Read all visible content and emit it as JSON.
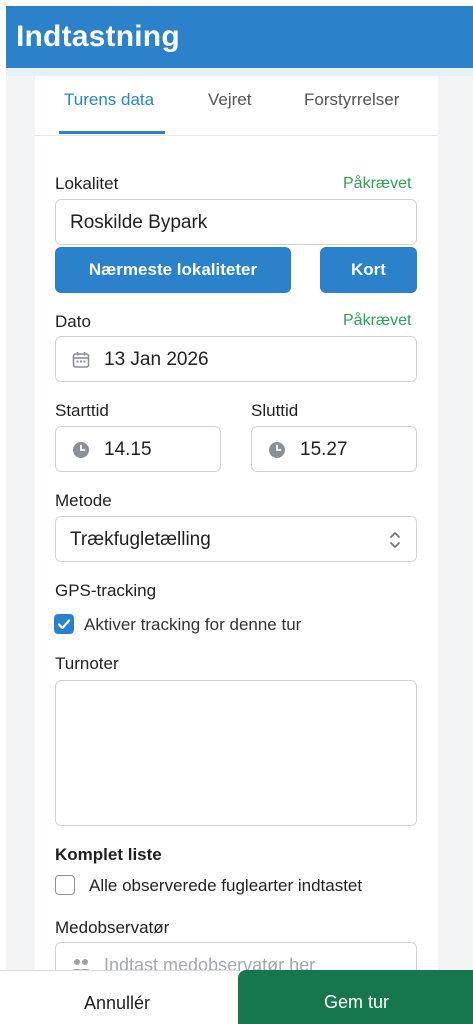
{
  "header": {
    "title": "Indtastning",
    "color": "#2b82cb"
  },
  "tabs": [
    {
      "label": "Turens data",
      "active": true
    },
    {
      "label": "Vejret",
      "active": false
    },
    {
      "label": "Forstyrrelser",
      "active": false
    }
  ],
  "locality": {
    "label": "Lokalitet",
    "required": "Påkrævet",
    "value": "Roskilde Bypark",
    "nearest_button": "Nærmeste lokaliteter",
    "map_button": "Kort"
  },
  "date": {
    "label": "Dato",
    "required": "Påkrævet",
    "value": "13 Jan 2026",
    "icon": "calendar-icon"
  },
  "start_time": {
    "label": "Starttid",
    "value": "14.15",
    "icon": "clock-icon"
  },
  "end_time": {
    "label": "Sluttid",
    "value": "15.27",
    "icon": "clock-icon"
  },
  "method": {
    "label": "Metode",
    "value": "Trækfugletælling",
    "icon": "updown-chevron-icon"
  },
  "gps": {
    "label": "GPS-tracking",
    "checkbox_label": "Aktiver tracking for denne tur",
    "checked": true
  },
  "notes": {
    "label": "Turnoter",
    "value": ""
  },
  "complete_list": {
    "label": "Komplet liste",
    "checkbox_label": "Alle observerede fuglearter indtastet",
    "checked": false
  },
  "co_observer": {
    "label": "Medobservatør",
    "placeholder": "Indtast medobservatør her",
    "icon": "people-icon"
  },
  "footer": {
    "cancel_label": "Annullér",
    "save_label": "Gem tur",
    "save_color": "#16774c"
  },
  "colors": {
    "accent": "#2b82cb",
    "required": "#2e9e58"
  }
}
